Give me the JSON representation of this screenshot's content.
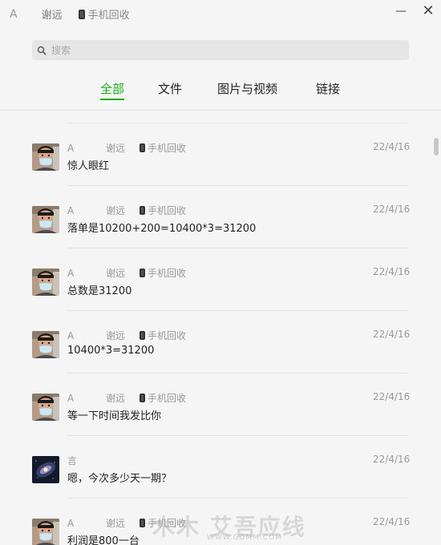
{
  "window": {
    "sender_letter": "A",
    "contact_name": "谢远",
    "group_name": "手机回收",
    "minimize_label": "—",
    "close_label": "✕"
  },
  "search": {
    "placeholder": "搜索"
  },
  "tabs": [
    {
      "label": "全部",
      "active": true
    },
    {
      "label": "文件"
    },
    {
      "label": "图片与视频"
    },
    {
      "label": "链接"
    }
  ],
  "messages": [
    {
      "sender": "A",
      "name": "谢远",
      "group": "手机回收",
      "date": "22/4/16",
      "text": "惊人眼红",
      "avatar": "man-mask"
    },
    {
      "sender": "A",
      "name": "谢远",
      "group": "手机回收",
      "date": "22/4/16",
      "text": "落单是10200+200=10400*3=31200",
      "avatar": "man-mask"
    },
    {
      "sender": "A",
      "name": "谢远",
      "group": "手机回收",
      "date": "22/4/16",
      "text": "总数是31200",
      "avatar": "man-mask"
    },
    {
      "sender": "A",
      "name": "谢远",
      "group": "手机回收",
      "date": "22/4/16",
      "text": "10400*3=31200",
      "avatar": "man-mask"
    },
    {
      "sender": "A",
      "name": "谢远",
      "group": "手机回收",
      "date": "22/4/16",
      "text": "等一下时间我发比你",
      "avatar": "man-mask"
    },
    {
      "sender": "言",
      "name": "",
      "group": "",
      "date": "22/4/16",
      "text": "嗯，今次多少天一期？",
      "avatar": "galaxy"
    },
    {
      "sender": "A",
      "name": "谢远",
      "group": "手机回收",
      "date": "22/4/16",
      "text": "利润是800一台",
      "avatar": "man-mask"
    }
  ],
  "watermark": {
    "text": "木木 艾吾应线",
    "url": "WWW.GDMM.COM"
  },
  "colors": {
    "accent": "#1aad19",
    "background": "#f5f5f5"
  }
}
